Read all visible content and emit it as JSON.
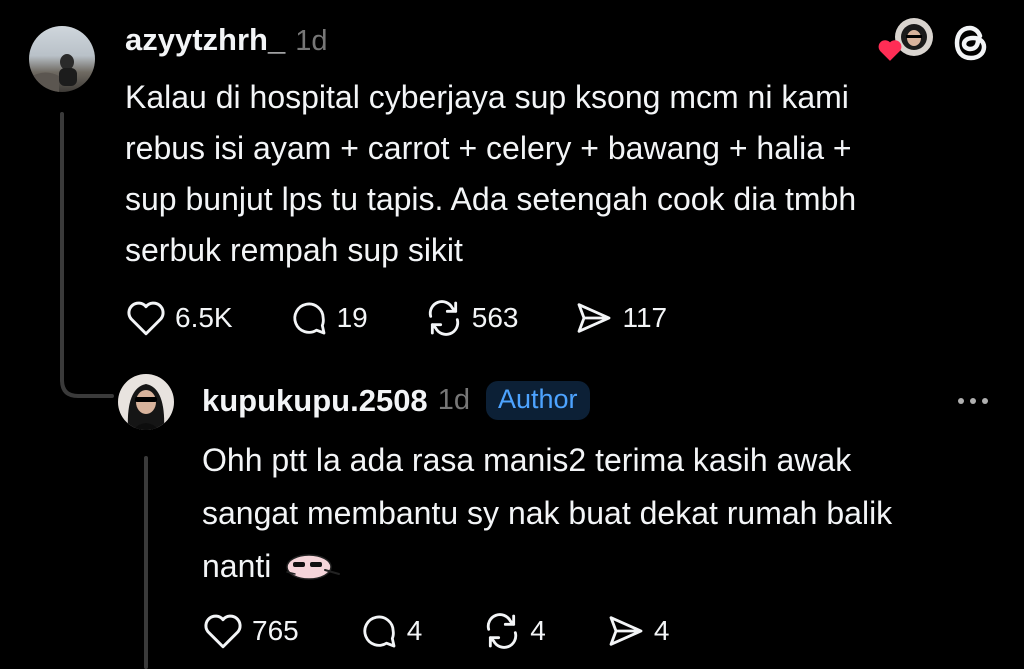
{
  "post": {
    "username": "azyytzhrh_",
    "time": "1d",
    "lines": [
      "Kalau di hospital cyberjaya sup ksong mcm ni kami",
      "rebus isi ayam + carrot + celery + bawang + halia +",
      "sup bunjut lps tu tapis. Ada setengah cook dia tmbh",
      "serbuk rempah sup sikit"
    ],
    "likes": "6.5K",
    "replies": "19",
    "reposts": "563",
    "shares": "117"
  },
  "reply": {
    "username": "kupukupu.2508",
    "time": "1d",
    "badge": "Author",
    "lines": [
      "Ohh ptt la ada rasa manis2 terima kasih awak",
      "sangat membantu sy nak buat dekat rumah balik",
      "nanti"
    ],
    "likes": "765",
    "replies": "4",
    "reposts": "4",
    "shares": "4"
  },
  "colors": {
    "background": "#000000",
    "text": "#f3f5f7",
    "muted": "#777777",
    "badge_text": "#4da3ff",
    "heart": "#ff2d55"
  },
  "icons": [
    "heart-icon",
    "comment-icon",
    "repost-icon",
    "share-icon",
    "threads-logo-icon",
    "more-icon",
    "liked-heart-icon"
  ]
}
